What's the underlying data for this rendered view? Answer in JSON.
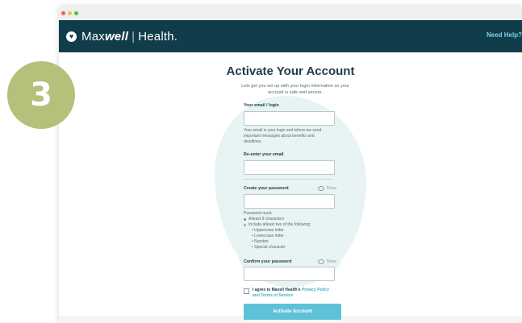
{
  "step": "3",
  "app": {
    "brand_max": "Max",
    "brand_well": "well",
    "brand_separator": "|",
    "brand_health": "Health.",
    "need_help": "Need Help?"
  },
  "page": {
    "title": "Activate Your Account",
    "subtitle": "Lets get you set up with your login information so your account is safe and secure."
  },
  "form": {
    "email_label": "Your email / login",
    "email_help": "Your email is your login and where we send important messages about benefits and deadlines.",
    "reenter_label": "Re-enter your email",
    "password_label": "Create your password",
    "show_label": "Show",
    "requirements_title": "Password must:",
    "req_min": "Atleast 9 characters",
    "req_two": "Include atleast two of the following:",
    "req_upper": "• Uppercase letter",
    "req_lower": "• Lowercase letter",
    "req_number": "• Number",
    "req_special": "• Special character",
    "confirm_label": "Confirm your password",
    "confirm_show_label": "Show",
    "agree_prefix": "I agree to Maxell Health's",
    "privacy_link": "Privacy Policy",
    "agree_and": "and",
    "terms_link": "Terms of Service",
    "submit_label": "Activate Account"
  },
  "colors": {
    "header": "#113c4a",
    "accent": "#5ec2d6",
    "step_badge": "#b3c17a",
    "blob": "#e8f3f4"
  }
}
